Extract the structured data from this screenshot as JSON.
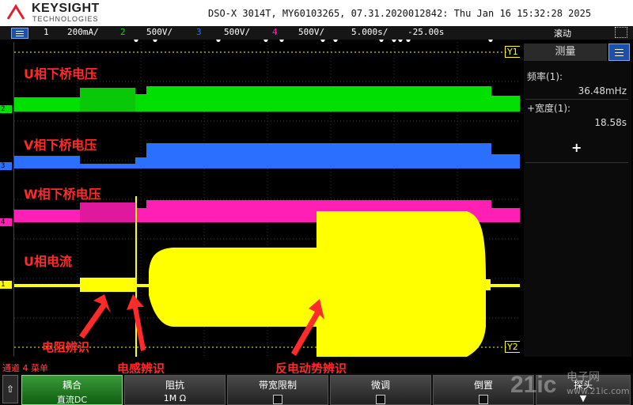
{
  "header": {
    "brand": "KEYSIGHT",
    "brand_sub": "TECHNOLOGIES",
    "model_info": "DSO-X 3014T, MY60103265, 07.31.2020012842: Thu Jan 16 15:32:28 2025"
  },
  "channel_bar": {
    "ch1_num": "1",
    "ch1_scale": "200mA/",
    "ch2_num": "2",
    "ch2_scale": "500V/",
    "ch3_num": "3",
    "ch3_scale": "500V/",
    "ch4_num": "4",
    "ch4_scale": "500V/",
    "timebase": "5.000s/",
    "delay": "-25.00s",
    "mode": "滚动"
  },
  "colors": {
    "ch1": "#ffff00",
    "ch2": "#00e000",
    "ch3": "#2b6fff",
    "ch4": "#ff1fb4",
    "annotation": "#ff2a2a"
  },
  "plot": {
    "label_u_bridge": "U相下桥电压",
    "label_v_bridge": "V相下桥电压",
    "label_w_bridge": "W相下桥电压",
    "label_u_current": "U相电流",
    "cursor_y1": "Y1",
    "cursor_y2": "Y2",
    "marker_1": "1",
    "marker_2": "2",
    "marker_3": "3",
    "marker_4": "4"
  },
  "annotations": {
    "resistance": "电阻辨识",
    "inductance": "电感辨识",
    "back_emf": "反电动势辨识"
  },
  "side_panel": {
    "title": "测量",
    "m1_label": "频率(1):",
    "m1_value": "36.48mHz",
    "m2_label": "+宽度(1):",
    "m2_value": "18.58s",
    "add": "+"
  },
  "status": {
    "left": "通道 4 菜单"
  },
  "softkeys": {
    "k1_title": "耦合",
    "k1_value": "直流DC",
    "k2_title": "阻抗",
    "k2_value": "1M Ω",
    "k3_title": "带宽限制",
    "k4_title": "微调",
    "k5_title": "倒置",
    "k6_title": "探头"
  },
  "watermark": {
    "logo": "21ic",
    "site": "电子网",
    "url": "www.21ic.com"
  }
}
